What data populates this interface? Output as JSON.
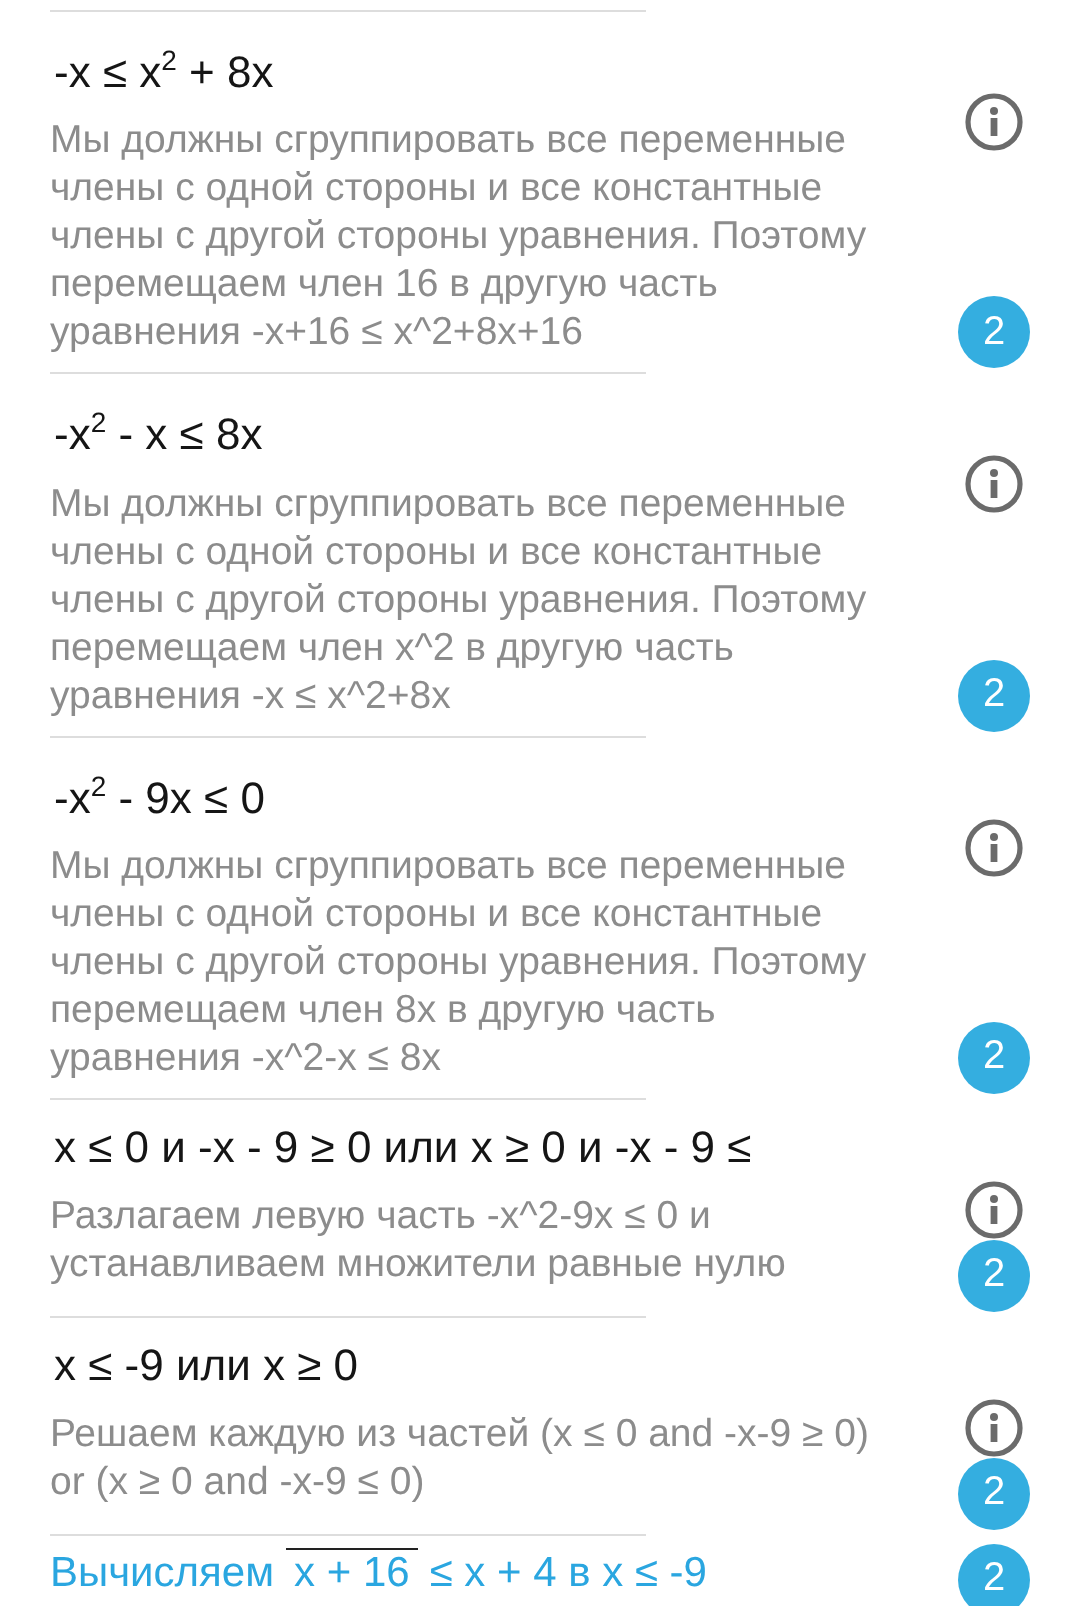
{
  "steps": [
    {
      "formula": "-x ≤ x$^{2}$ + 8x",
      "explanation": "Мы должны сгруппировать все переменные члены с одной стороны и все константные члены с другой стороны уравнения. Поэтому перемещаем член 16 в другую часть уравнения -x+16 ≤ x^2+8x+16",
      "badge": "2"
    },
    {
      "formula": "-x$^{2}$ - x ≤ 8x",
      "explanation": "Мы должны сгруппировать все переменные члены с одной стороны и все константные члены с другой стороны уравнения. Поэтому перемещаем член x^2 в другую часть уравнения -x ≤ x^2+8x",
      "badge": "2"
    },
    {
      "formula": "-x$^{2}$ - 9x ≤ 0",
      "explanation": "Мы должны сгруппировать все переменные члены с одной стороны и все константные члены с другой стороны уравнения. Поэтому перемещаем член 8x в другую часть уравнения -x^2-x ≤ 8x",
      "badge": "2"
    },
    {
      "formula": "x ≤ 0 и -x - 9 ≥ 0 или x ≥ 0 и -x - 9 ≤",
      "explanation": "Разлагаем левую часть -x^2-9x ≤ 0 и устанавливаем множители равные нулю",
      "badge": "2"
    },
    {
      "formula": "x ≤ -9 или x ≥ 0",
      "explanation": "Решаем каждую из частей (x ≤ 0 and -x-9 ≥ 0) or (x ≥ 0 and -x-9 ≤ 0)",
      "badge": "2"
    }
  ],
  "final": {
    "label": "Вычисляем",
    "radicand": "x + 16",
    "rest": "≤ x + 4 в x ≤ -9",
    "badge": "2"
  }
}
